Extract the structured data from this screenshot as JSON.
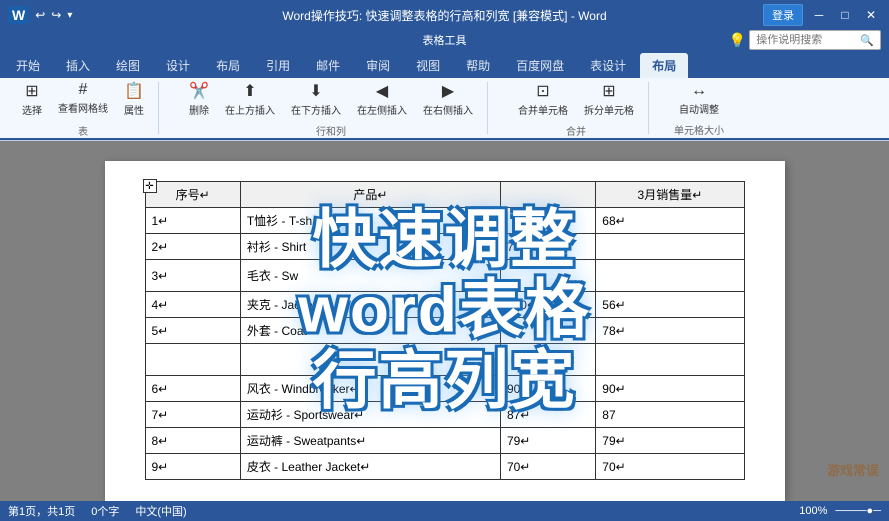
{
  "titlebar": {
    "title": "Word操作技巧: 快速调整表格的行高和列宽 [兼容模式] - Word",
    "app_name": "Word",
    "login_label": "登录",
    "quick_access": [
      "↩",
      "↪",
      "⬇"
    ]
  },
  "table_tools": {
    "label": "表格工具"
  },
  "ribbon": {
    "tabs": [
      {
        "label": "开始",
        "active": false
      },
      {
        "label": "插入",
        "active": false
      },
      {
        "label": "绘图",
        "active": false
      },
      {
        "label": "设计",
        "active": false
      },
      {
        "label": "布局",
        "active": false
      },
      {
        "label": "引用",
        "active": false
      },
      {
        "label": "邮件",
        "active": false
      },
      {
        "label": "审阅",
        "active": false
      },
      {
        "label": "视图",
        "active": false
      },
      {
        "label": "帮助",
        "active": false
      },
      {
        "label": "百度网盘",
        "active": false
      },
      {
        "label": "表设计",
        "active": false
      },
      {
        "label": "布局",
        "active": true
      }
    ],
    "search_placeholder": "操作说明搜索"
  },
  "overlay": {
    "line1": "快速调整",
    "line2": "word表格",
    "line3": "行高列宽"
  },
  "table": {
    "headers": [
      "序号",
      "产品",
      "",
      "3月销售量"
    ],
    "rows": [
      {
        "num": "1",
        "product": "T恤衫 - T-sh",
        "col3": "",
        "sales": "68"
      },
      {
        "num": "2",
        "product": "衬衫 - Shirt",
        "col3": "78",
        "sales": ""
      },
      {
        "num": "3",
        "product": "毛衣 - Sw",
        "col3": "",
        "sales": ""
      },
      {
        "num": "4",
        "product": "夹克 - Jacket",
        "col3": "150",
        "sales": "56"
      },
      {
        "num": "5",
        "product": "外套 - Coat",
        "col3": "",
        "sales": "78"
      },
      {
        "num": "6",
        "product": "风衣 - Windbreaker",
        "col3": "90",
        "sales": "90"
      },
      {
        "num": "7",
        "product": "运动衫 - Sportswear",
        "col3": "87",
        "sales": "87"
      },
      {
        "num": "8",
        "product": "运动裤 - Sweatpants",
        "col3": "79",
        "sales": "79"
      },
      {
        "num": "9",
        "product": "皮衣 - Leather Jacket",
        "col3": "70",
        "sales": "70"
      }
    ]
  },
  "watermark": {
    "text": "游戏常误"
  },
  "statusbar": {
    "page_info": "第1页，共1页",
    "word_count": "0个字",
    "lang": "中文(中国)",
    "zoom": "100%"
  },
  "window_controls": {
    "minimize": "─",
    "restore": "□",
    "close": "✕"
  }
}
